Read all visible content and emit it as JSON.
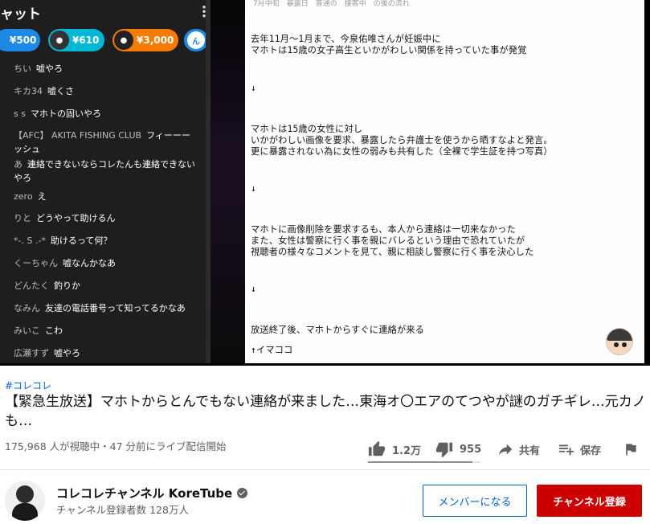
{
  "colors": {
    "accent_blue": "#065fd4",
    "subscribe_red": "#cc0000",
    "superchat_blue": "#1e88e5",
    "superchat_cyan": "#00b8d4",
    "superchat_orange": "#f57c00"
  },
  "chat": {
    "title": "ャット",
    "superchats": [
      {
        "amount": "¥500",
        "color": "#1e88e5",
        "avatar_icon": "avatar-icon"
      },
      {
        "amount": "¥610",
        "color": "#00b8d4",
        "avatar_icon": "avatar-icon"
      },
      {
        "amount": "¥3,000",
        "color": "#f57c00",
        "avatar_icon": "avatar-icon"
      },
      {
        "amount": "ん",
        "color": "#1e88e5",
        "avatar_icon": "avatar-icon"
      }
    ],
    "messages": [
      {
        "author": "ちい",
        "text": "嘘やろ"
      },
      {
        "author": "キカ34",
        "text": "嘘くさ"
      },
      {
        "author": "s s",
        "text": "マホトの固いやろ"
      },
      {
        "author": "【AFC】 AKITA FISHING CLUB",
        "text": "フィーーーッシュ"
      },
      {
        "author": "あ",
        "text": "連絡できないならコレたんも連絡できないやろ"
      },
      {
        "author": "zero",
        "text": "え"
      },
      {
        "author": "りと",
        "text": "どうやって助けるん"
      },
      {
        "author": "*-. S .-*",
        "text": "助けるって何？"
      },
      {
        "author": "くーちゃん",
        "text": "嘘なんかなあ"
      },
      {
        "author": "どんたく",
        "text": "釣りか"
      },
      {
        "author": "なみん",
        "text": "友達の電話番号って知ってるかなあ"
      },
      {
        "author": "みいこ",
        "text": "こわ"
      },
      {
        "author": "広瀬すず",
        "text": "嘘やろ"
      }
    ]
  },
  "doc": {
    "top_note": "7月中旬　暴露日　普通の　接客中　の後の流れ",
    "lines": [
      "去年11月～1月まで、今泉佑唯さんが妊娠中に",
      "マホトは15歳の女子高生といかがわしい関係を持っていた事が発覚",
      "↓",
      "マホトは15歳の女性に対し",
      "いかがわしい画像を要求、暴露したら弁護士を使うから晒すなよと発言。",
      "更に暴露されない為に女性の弱みも共有した（全裸で学生証を持つ写真）",
      "↓",
      "マホトに画像削除を要求するも、本人から連絡は一切来なかった",
      "また、女性は警察に行く事を親にバレるという理由で恐れていたが",
      "視聴者の様々なコメントを見て、親に相談し警察に行く事を決心した",
      "↓",
      "放送終了後、マホトからすぐに連絡が来る",
      "↑イマココ"
    ]
  },
  "video": {
    "hashtag": "#コレコレ",
    "title": "【緊急生放送】マホトからとんでもない連絡が来ました…東海オ〇エアのてつやが謎のガチギレ…元カノも…",
    "view_info": "175,968 人が視聴中・47 分前にライブ配信開始",
    "likes": "1.2万",
    "dislikes": "955",
    "share_label": "共有",
    "save_label": "保存",
    "like_ratio": 0.93
  },
  "channel": {
    "name": "コレコレチャンネル KoreTube",
    "subscribers": "チャンネル登録者数 128万人",
    "join_label": "メンバーになる",
    "subscribe_label": "チャンネル登録"
  }
}
